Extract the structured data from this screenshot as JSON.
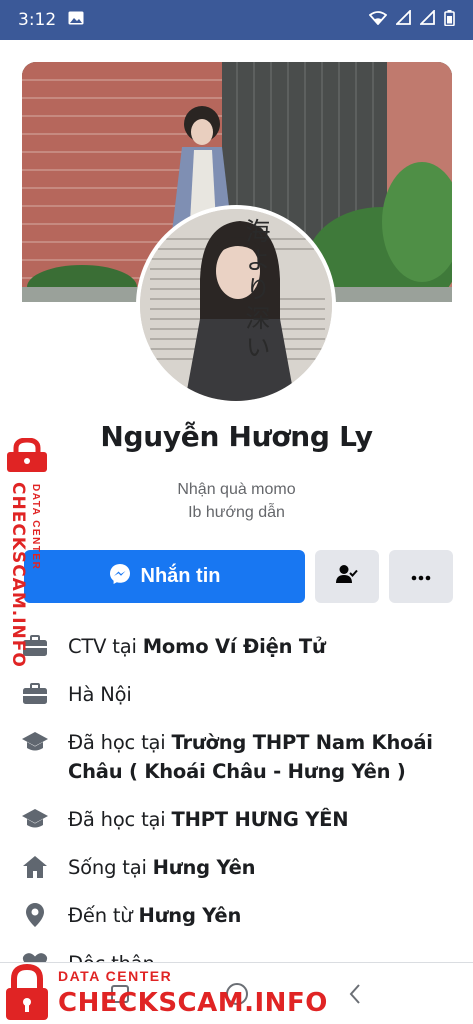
{
  "status_bar": {
    "time": "3:12"
  },
  "profile": {
    "name": "Nguyễn Hương Ly",
    "bio_line1": "Nhận quà momo",
    "bio_line2": "Ib hướng dẫn",
    "avatar_text": "海より深い"
  },
  "actions": {
    "message_label": "Nhắn tin"
  },
  "info": [
    {
      "icon": "briefcase-icon",
      "prefix": "CTV tại ",
      "bold": "Momo Ví Điện Tử"
    },
    {
      "icon": "briefcase-icon",
      "prefix": "Hà Nội",
      "bold": ""
    },
    {
      "icon": "graduation-cap-icon",
      "prefix": "Đã học tại ",
      "bold": "Trường THPT Nam Khoái Châu ( Khoái Châu - Hưng Yên )"
    },
    {
      "icon": "graduation-cap-icon",
      "prefix": "Đã học tại ",
      "bold": "THPT HƯNG YÊN"
    },
    {
      "icon": "home-icon",
      "prefix": "Sống tại ",
      "bold": "Hưng Yên"
    },
    {
      "icon": "location-pin-icon",
      "prefix": "Đến từ ",
      "bold": "Hưng Yên"
    },
    {
      "icon": "heart-icon",
      "prefix": "Độc thân",
      "bold": ""
    }
  ],
  "watermark": {
    "line1": "DATA CENTER",
    "line2": "CHECKSCAM.INFO"
  },
  "colors": {
    "status_bar": "#3b5998",
    "primary_button": "#1877f2",
    "watermark": "#e02424"
  }
}
